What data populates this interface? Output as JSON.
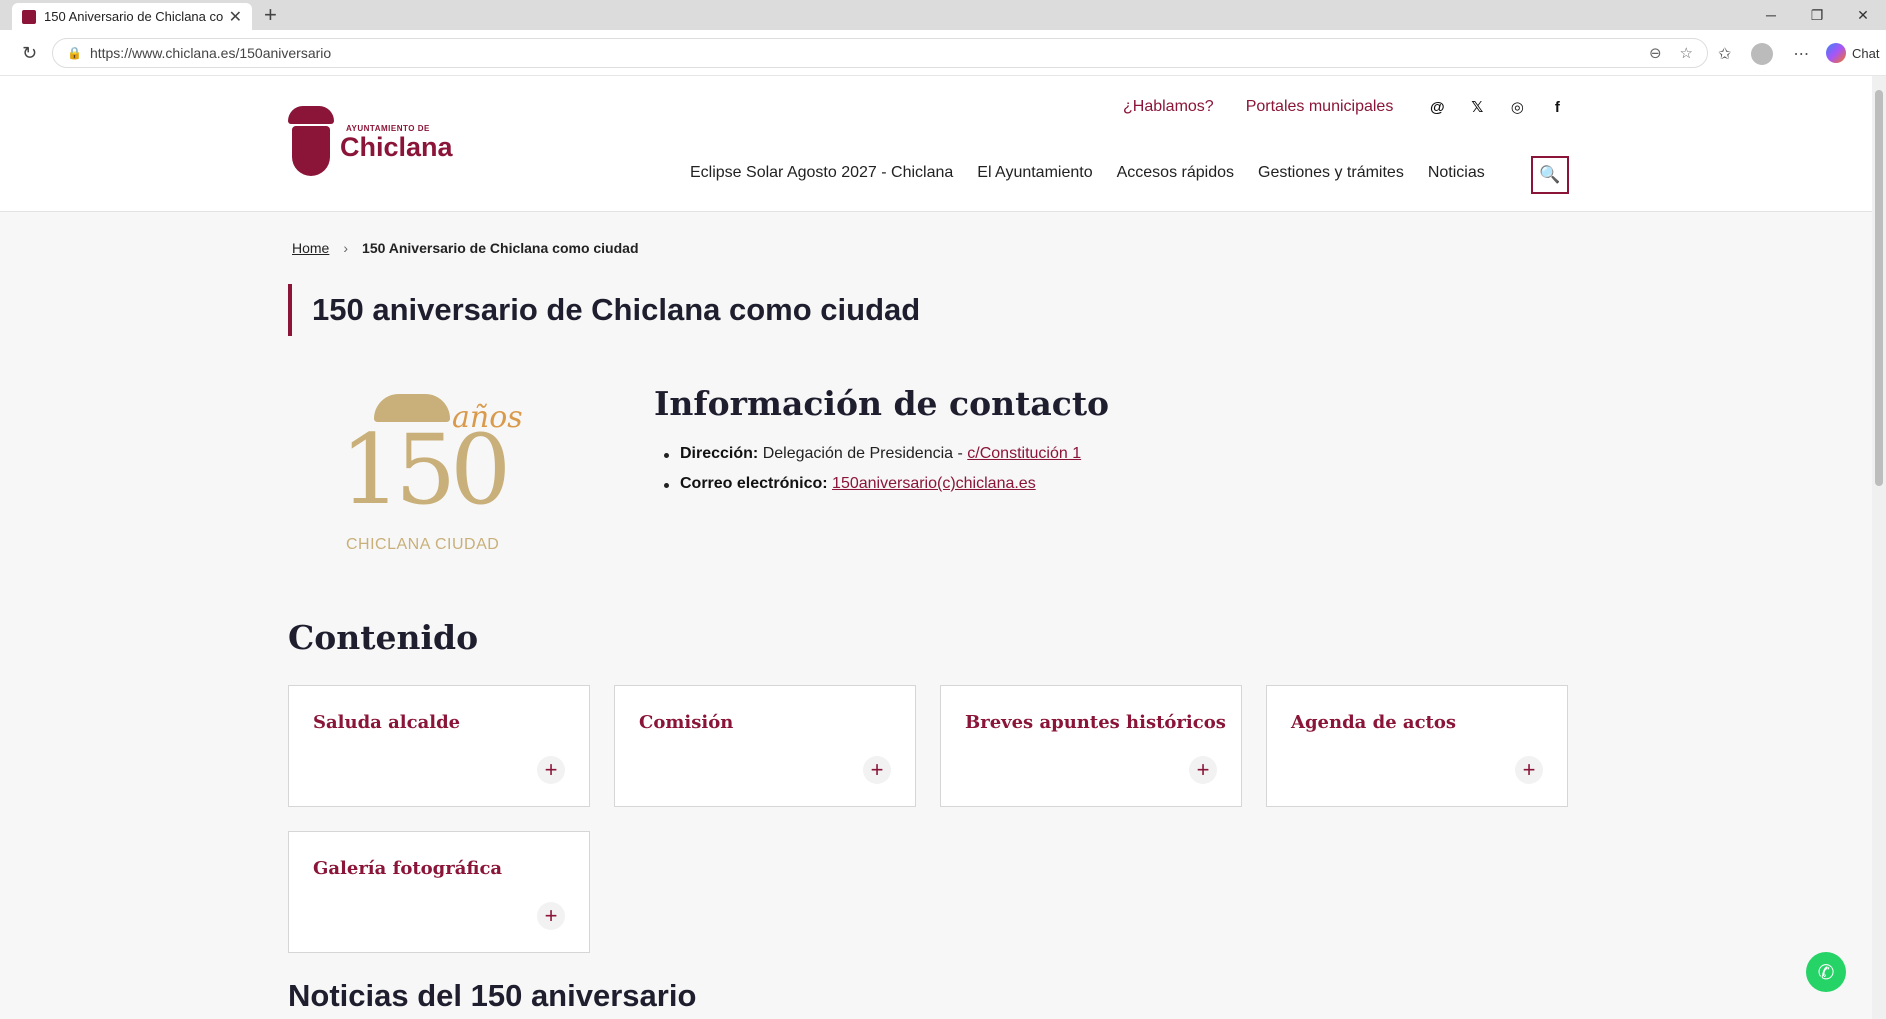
{
  "browser": {
    "tab_title": "150 Aniversario de Chiclana como",
    "url": "https://www.chiclana.es/150aniversario",
    "chat_label": "Chat"
  },
  "header": {
    "logo_small": "AYUNTAMIENTO DE",
    "logo_big": "Chiclana",
    "top_links": [
      "¿Hablamos?",
      "Portales municipales"
    ],
    "social_icons": [
      "threads-icon",
      "x-icon",
      "instagram-icon",
      "facebook-icon"
    ],
    "nav": [
      "Eclipse Solar Agosto 2027 - Chiclana",
      "El Ayuntamiento",
      "Accesos rápidos",
      "Gestiones y trámites",
      "Noticias"
    ]
  },
  "breadcrumb": {
    "home": "Home",
    "current": "150 Aniversario de Chiclana como ciudad"
  },
  "page": {
    "title": "150 aniversario de Chiclana como ciudad",
    "anniv_logo": {
      "anos": "años",
      "number": "150",
      "subtitle": "CHICLANA CIUDAD"
    },
    "contact": {
      "heading": "Información de contacto",
      "address_label": "Dirección:",
      "address_text": "Delegación de Presidencia -",
      "address_link": "c/Constitución 1",
      "email_label": "Correo electrónico:",
      "email_link": "150aniversario(c)chiclana.es"
    },
    "content_heading": "Contenido",
    "cards": [
      "Saluda alcalde",
      "Comisión",
      "Breves apuntes históricos",
      "Agenda de actos",
      "Galería fotográfica"
    ],
    "news_heading": "Noticias del 150 aniversario"
  },
  "colors": {
    "brand": "#8a1538",
    "gold": "#c9b07a"
  }
}
